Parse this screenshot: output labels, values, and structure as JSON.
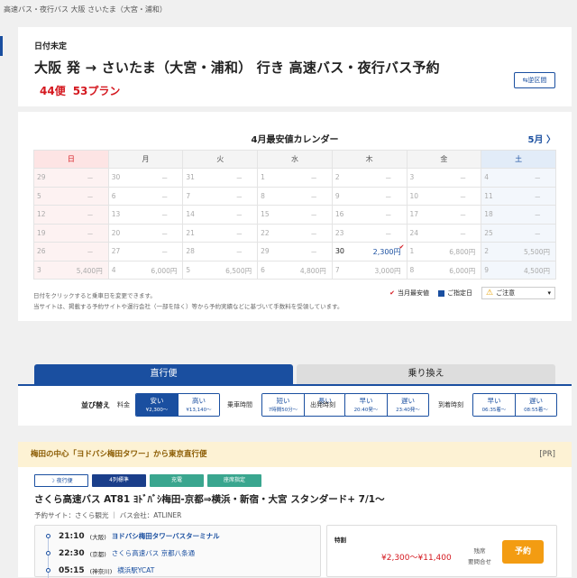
{
  "breadcrumb": "高速バス・夜行バス 大阪 さいたま（大宮・浦和）",
  "header": {
    "date_status": "日付未定",
    "title": "大阪 発 → さいたま（大宮・浦和） 行き 高速バス・夜行バス予約",
    "flights": "44便",
    "plans": "53プラン",
    "swap_label": "⇆逆区間"
  },
  "calendar": {
    "title": "4月最安値カレンダー",
    "next_label": "5月 〉",
    "weekdays": [
      "日",
      "月",
      "火",
      "水",
      "木",
      "金",
      "土"
    ],
    "weeks": [
      [
        {
          "d": "29",
          "p": "－"
        },
        {
          "d": "30",
          "p": "－"
        },
        {
          "d": "31",
          "p": "－"
        },
        {
          "d": "1",
          "p": "－"
        },
        {
          "d": "2",
          "p": "－"
        },
        {
          "d": "3",
          "p": "－"
        },
        {
          "d": "4",
          "p": "－"
        }
      ],
      [
        {
          "d": "5",
          "p": "－"
        },
        {
          "d": "6",
          "p": "－"
        },
        {
          "d": "7",
          "p": "－"
        },
        {
          "d": "8",
          "p": "－"
        },
        {
          "d": "9",
          "p": "－"
        },
        {
          "d": "10",
          "p": "－"
        },
        {
          "d": "11",
          "p": "－"
        }
      ],
      [
        {
          "d": "12",
          "p": "－"
        },
        {
          "d": "13",
          "p": "－"
        },
        {
          "d": "14",
          "p": "－"
        },
        {
          "d": "15",
          "p": "－"
        },
        {
          "d": "16",
          "p": "－"
        },
        {
          "d": "17",
          "p": "－"
        },
        {
          "d": "18",
          "p": "－"
        }
      ],
      [
        {
          "d": "19",
          "p": "－"
        },
        {
          "d": "20",
          "p": "－"
        },
        {
          "d": "21",
          "p": "－"
        },
        {
          "d": "22",
          "p": "－"
        },
        {
          "d": "23",
          "p": "－"
        },
        {
          "d": "24",
          "p": "－"
        },
        {
          "d": "25",
          "p": "－"
        }
      ],
      [
        {
          "d": "26",
          "p": "－"
        },
        {
          "d": "27",
          "p": "－"
        },
        {
          "d": "28",
          "p": "－"
        },
        {
          "d": "29",
          "p": "－"
        },
        {
          "d": "30",
          "p": "2,300円",
          "active": true
        },
        {
          "d": "1",
          "p": "6,800円"
        },
        {
          "d": "2",
          "p": "5,500円"
        }
      ],
      [
        {
          "d": "3",
          "p": "5,400円"
        },
        {
          "d": "4",
          "p": "6,000円"
        },
        {
          "d": "5",
          "p": "6,500円"
        },
        {
          "d": "6",
          "p": "4,800円"
        },
        {
          "d": "7",
          "p": "3,000円"
        },
        {
          "d": "8",
          "p": "6,000円"
        },
        {
          "d": "9",
          "p": "4,500円"
        }
      ]
    ],
    "note1": "日付をクリックすると乗車日を変更できます。",
    "note2": "当サイトは、掲載する予約サイトや運行会社（一部を除く）等から予約実績などに基づいて手数料を受領しています。",
    "legend_cheapest": "当月最安値",
    "legend_selected": "ご指定日",
    "caution_label": "ご注意"
  },
  "tabs": {
    "direct": "直行便",
    "transfer": "乗り換え"
  },
  "sort": {
    "label": "並び替え",
    "fare_label": "料金",
    "fare_cheap": "安い",
    "fare_cheap_sub": "¥2,300〜",
    "fare_high": "高い",
    "fare_high_sub": "¥13,140〜",
    "duration_label": "乗車時間",
    "dur_short": "短い",
    "dur_short_sub": "7時間50分〜",
    "dur_long": "長い",
    "dur_long_sub": "",
    "dep_label": "出発時刻",
    "dep_early": "早い",
    "dep_early_sub": "20:40発〜",
    "dep_late": "遅い",
    "dep_late_sub": "23:40発〜",
    "arr_label": "到着時刻",
    "arr_early": "早い",
    "arr_early_sub": "06:35着〜",
    "arr_late": "遅い",
    "arr_late_sub": "08:55着〜"
  },
  "result": {
    "head": "梅田の中心「ヨドバシ梅田タワー」から東京直行便",
    "pr": "[PR]",
    "badges": [
      "夜行便",
      "4列標準",
      "充電",
      "座席指定"
    ],
    "bus_name": "さくら高速バス AT81 ﾖﾄﾞﾊﾞｼ梅田-京都⇒横浜・新宿・大宮 スタンダード+ 7/1〜",
    "meta": "予約サイト：さくら観光 ｜ バス会社：ATLINER",
    "stops": [
      {
        "time": "21:10",
        "area": "(大阪)",
        "name": "ヨドバシ梅田タワーバスターミナル"
      },
      {
        "time": "22:30",
        "area": "(京都)",
        "name": "さくら高速バス 京都八条通"
      },
      {
        "time": "05:15",
        "area": "(神奈川)",
        "name": "横浜駅YCAT"
      }
    ],
    "plan_label": "特割",
    "price": "¥2,300〜¥11,400",
    "seat1": "残席",
    "seat2": "要問合せ",
    "reserve": "予約"
  }
}
